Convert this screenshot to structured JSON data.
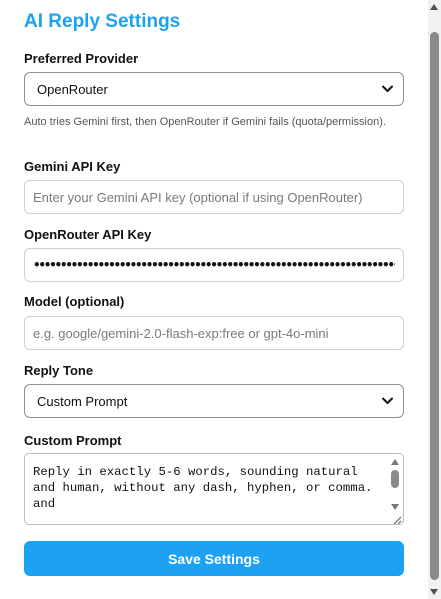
{
  "title": "AI Reply Settings",
  "provider": {
    "label": "Preferred Provider",
    "selected": "OpenRouter",
    "help": "Auto tries Gemini first, then OpenRouter if Gemini fails (quota/permission)."
  },
  "gemini": {
    "label": "Gemini API Key",
    "value": "",
    "placeholder": "Enter your Gemini API key (optional if using OpenRouter)"
  },
  "openrouter": {
    "label": "OpenRouter API Key",
    "masked_value": "••••••••••••••••••••••••••••••••••••••••••••••••••••••••••••••••••••••••"
  },
  "model": {
    "label": "Model (optional)",
    "value": "",
    "placeholder": "e.g. google/gemini-2.0-flash-exp:free or gpt-4o-mini"
  },
  "tone": {
    "label": "Reply Tone",
    "selected": "Custom Prompt"
  },
  "custom_prompt": {
    "label": "Custom Prompt",
    "value": "Reply in exactly 5-6 words, sounding natural and human, without any dash, hyphen, or comma. and\n\n/human make it sound like human"
  },
  "save_label": "Save Settings",
  "colors": {
    "accent": "#1da1f2",
    "button_text": "#ffffff"
  },
  "icons": {
    "select_arrow": "chevron-down-icon",
    "resize": "resize-grip-icon"
  }
}
